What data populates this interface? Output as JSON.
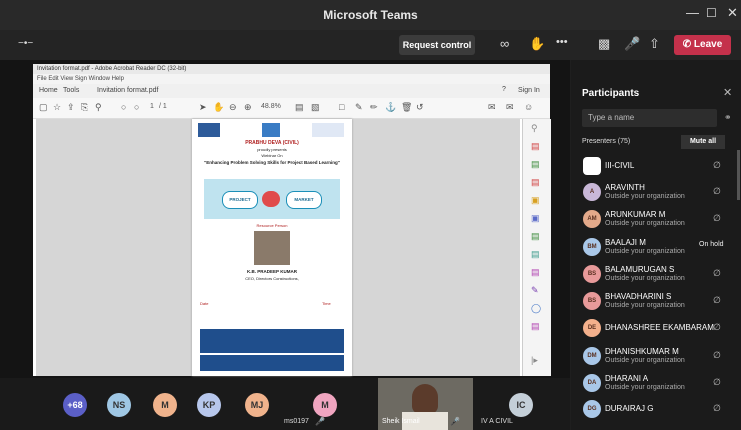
{
  "window": {
    "title": "Microsoft Teams"
  },
  "toolbar": {
    "request_control": "Request control",
    "leave": "Leave"
  },
  "acrobat": {
    "title": "Invitation format.pdf - Adobe Acrobat Reader DC (32-bit)",
    "menu": "File  Edit  View  Sign  Window  Help",
    "tabs": {
      "home": "Home",
      "tools": "Tools",
      "doc": "Invitation format.pdf"
    },
    "help": "?",
    "sign_in": "Sign In",
    "page_current": "1",
    "page_total": "/ 1",
    "zoom": "48.8%"
  },
  "doc": {
    "banner": "PRABHU DEVA (CIVIL)",
    "organize": "proudly presents",
    "webinar_on": "Webinar On",
    "topic": "\"Enhancing Problem Solving Skills for Project Based Learning\"",
    "labels": {
      "project": "PROJECT",
      "market": "MARKET"
    },
    "resource": "Resource Person",
    "speaker": "K.B. PRADEEP KUMAR",
    "speaker_role": "CEO, Directors Constructions,",
    "date_label": "Date",
    "time_label": "Time"
  },
  "participants": {
    "title": "Participants",
    "search_placeholder": "Type a name",
    "presenters": "Presenters (75)",
    "mute_all": "Mute all",
    "list": [
      {
        "initials": "",
        "name": "III-CIVIL",
        "sub": "",
        "status": "",
        "color": "#ffffff"
      },
      {
        "initials": "A",
        "name": "ARAVINTH",
        "sub": "Outside your organization",
        "status": "",
        "color": "#c9b8d8"
      },
      {
        "initials": "AM",
        "name": "ARUNKUMAR M",
        "sub": "Outside your organization",
        "status": "",
        "color": "#e3a98a"
      },
      {
        "initials": "BM",
        "name": "BAALAJI M",
        "sub": "Outside your organization",
        "status": "On hold",
        "color": "#a9c7e8"
      },
      {
        "initials": "BS",
        "name": "BALAMURUGAN S",
        "sub": "Outside your organization",
        "status": "",
        "color": "#e89a9a"
      },
      {
        "initials": "BS",
        "name": "BHAVADHARINI S",
        "sub": "Outside your organization",
        "status": "",
        "color": "#e89a9a"
      },
      {
        "initials": "DE",
        "name": "DHANASHREE EKAMBARAM",
        "sub": "",
        "status": "",
        "color": "#f3b08c"
      },
      {
        "initials": "DM",
        "name": "DHANISHKUMAR M",
        "sub": "Outside your organization",
        "status": "",
        "color": "#a9c7e8"
      },
      {
        "initials": "DA",
        "name": "DHARANI A",
        "sub": "Outside your organization",
        "status": "",
        "color": "#a9c7e8"
      },
      {
        "initials": "DG",
        "name": "DURAIRAJ G",
        "sub": "",
        "status": "",
        "color": "#a9c7e8"
      }
    ]
  },
  "strip": {
    "overflow": "+68",
    "avatars": [
      {
        "initials": "NS",
        "color": "#9fc7e4"
      },
      {
        "initials": "M",
        "color": "#f0b38c"
      },
      {
        "initials": "KP",
        "color": "#b7c7ec"
      },
      {
        "initials": "MJ",
        "color": "#f0b38c"
      },
      {
        "initials": "M",
        "color": "#f0a5c0"
      },
      {
        "initials": "IC",
        "color": "#c4cfd8"
      }
    ],
    "labels": {
      "tile1": "ms0197",
      "video": "Sheik Ismail",
      "tile_ic": "IV A CIVIL"
    }
  }
}
